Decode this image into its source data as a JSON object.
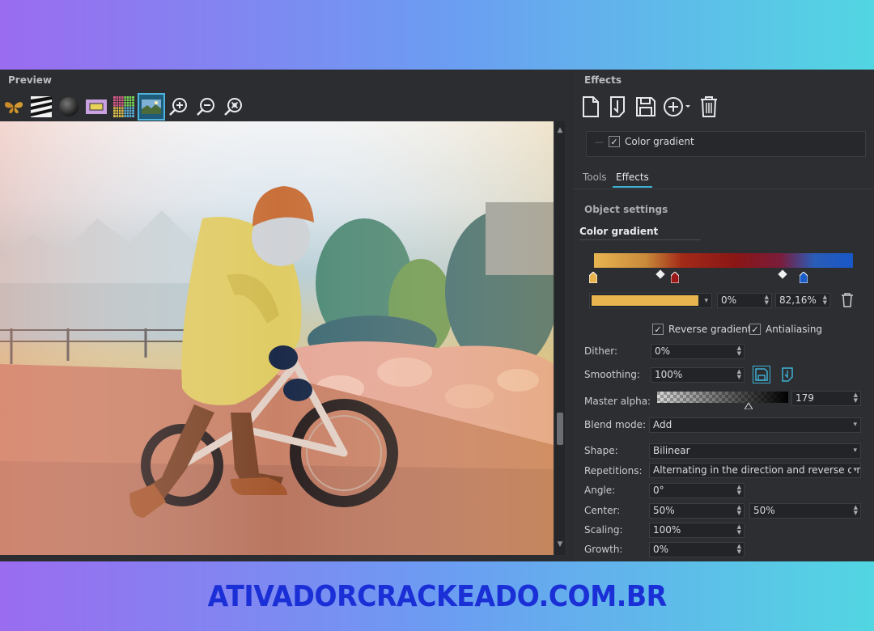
{
  "preview": {
    "title": "Preview",
    "toolbar_icons": [
      "butterfly-icon",
      "zebra-icon",
      "sphere-icon",
      "frame-icon",
      "mosaic-icon",
      "photo-icon",
      "zoom-in-icon",
      "zoom-out-icon",
      "zoom-fit-icon"
    ]
  },
  "effects": {
    "title": "Effects",
    "toolbar_icons": [
      "new-document-icon",
      "open-file-icon",
      "save-icon",
      "add-effect-icon",
      "delete-icon"
    ],
    "tree": [
      {
        "label": "Color gradient",
        "checked": true
      }
    ],
    "tabs": [
      {
        "label": "Tools",
        "active": false
      },
      {
        "label": "Effects",
        "active": true
      }
    ],
    "object_settings": "Object settings",
    "section": "Color gradient",
    "gradient": {
      "stop_position": "0%",
      "stop_value": "82,16%",
      "stop_color": "#e8b450"
    },
    "reverse_gradient": {
      "label": "Reverse gradient",
      "checked": true
    },
    "antialiasing": {
      "label": "Antialiasing",
      "checked": true
    },
    "settings": [
      {
        "label": "Dither:",
        "value": "0%"
      },
      {
        "label": "Smoothing:",
        "value": "100%"
      },
      {
        "label": "Master alpha:",
        "value": "179"
      },
      {
        "label": "Blend mode:",
        "value": "Add"
      },
      {
        "label": "Shape:",
        "value": "Bilinear"
      },
      {
        "label": "Repetitions:",
        "value": "Alternating in the direction and reverse direct"
      },
      {
        "label": "Angle:",
        "value": "0°"
      },
      {
        "label": "Center:",
        "value": "50%",
        "value2": "50%"
      },
      {
        "label": "Scaling:",
        "value": "100%"
      },
      {
        "label": "Growth:",
        "value": "0%"
      }
    ]
  },
  "footer": {
    "text": "ATIVADORCRACKEADO.COM.BR"
  },
  "colors": {
    "accent": "#3fb2d8",
    "panel_bg": "#2b2d30",
    "footer_text": "#1b2fd6"
  }
}
